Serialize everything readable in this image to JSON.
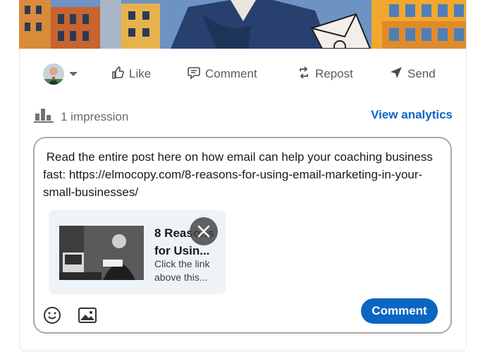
{
  "post": {
    "image": {
      "icon": "illustration-banner"
    }
  },
  "actions": {
    "like_label": "Like",
    "comment_label": "Comment",
    "repost_label": "Repost",
    "send_label": "Send"
  },
  "stats": {
    "impressions_label": "1 impression",
    "view_analytics_label": "View analytics"
  },
  "composer": {
    "text": " Read the entire post here on how email can help your coaching business fast: https://elmocopy.com/8-reasons-for-using-email-marketing-in-your-small-businesses/",
    "link_preview": {
      "title": "8 Reasons for Usin...",
      "description": "Click the link above this..."
    },
    "submit_label": "Comment"
  },
  "colors": {
    "accent": "#0a66c2",
    "composer_border": "#a9a9a9",
    "link_card_bg": "#eef3f8"
  }
}
